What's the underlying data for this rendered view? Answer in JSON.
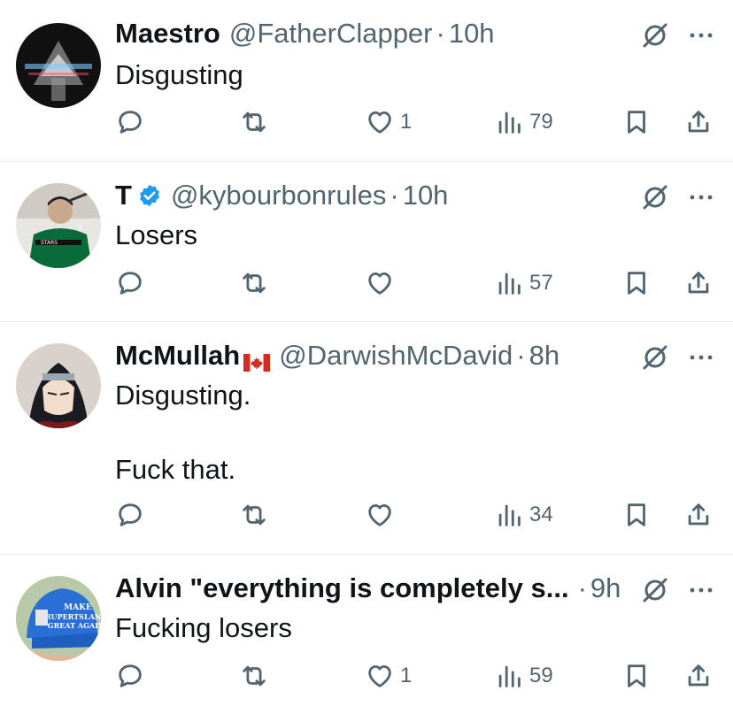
{
  "replies": [
    {
      "name": "Maestro",
      "handle": "@FatherClapper",
      "sep": "·",
      "time": "10h",
      "text": "Disgusting",
      "verified": false,
      "flag": "",
      "counts": {
        "reply": "",
        "repost": "",
        "like": "1",
        "views": "79"
      }
    },
    {
      "name": "T",
      "handle": "@kybourbonrules",
      "sep": "·",
      "time": "10h",
      "text": "Losers",
      "verified": true,
      "flag": "",
      "counts": {
        "reply": "",
        "repost": "",
        "like": "",
        "views": "57"
      }
    },
    {
      "name": "McMullah",
      "handle": "@DarwishMcDavid",
      "sep": "·",
      "time": "8h",
      "text": "Disgusting.\n\nFuck that.",
      "verified": false,
      "flag": "canada-flag",
      "counts": {
        "reply": "",
        "repost": "",
        "like": "",
        "views": "34"
      }
    },
    {
      "name": "Alvin \"everything is completely s...",
      "handle": "",
      "sep": "·",
      "time": "9h",
      "text": "Fucking losers",
      "verified": false,
      "flag": "",
      "counts": {
        "reply": "",
        "repost": "",
        "like": "1",
        "views": "59"
      }
    }
  ],
  "hat_text": "MAKE RUPERTSLAND GREAT AGAIN",
  "colors": {
    "text": "#0f1419",
    "secondary": "#536471",
    "verified": "#1d9bf0",
    "divider": "#e7e9ea"
  }
}
